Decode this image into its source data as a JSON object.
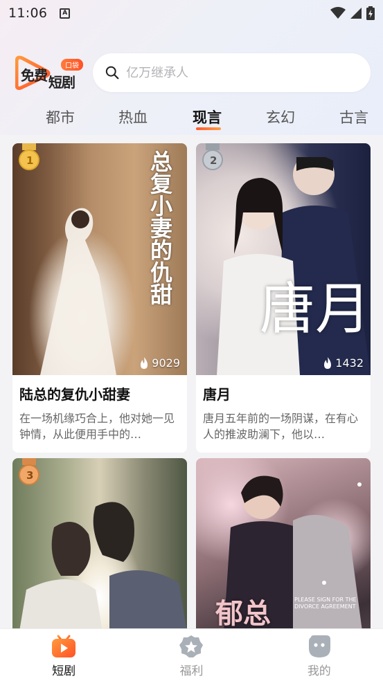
{
  "status": {
    "time": "11:06",
    "app_icon": "A"
  },
  "brand": {
    "text1": "免费",
    "text2": "短剧",
    "badge": "口袋"
  },
  "search": {
    "placeholder": "亿万继承人"
  },
  "tabs": [
    {
      "label": "都市"
    },
    {
      "label": "热血"
    },
    {
      "label": "现言"
    },
    {
      "label": "玄幻"
    },
    {
      "label": "古言"
    }
  ],
  "active_tab": "现言",
  "cards": [
    {
      "rank": "1",
      "views": "9029",
      "title": "陆总的复仇小甜妻",
      "desc": "在一场机缘巧合上，他对她一见钟情，从此便用手中的…",
      "poster_text": "总复小妻的仇甜"
    },
    {
      "rank": "2",
      "views": "1432",
      "title": "唐月",
      "desc": "唐月五年前的一场阴谋，在有心人的推波助澜下，他以…",
      "poster_text": "唐月"
    },
    {
      "rank": "3",
      "views": "",
      "title": "",
      "desc": "",
      "poster_text": ""
    },
    {
      "rank": "",
      "views": "",
      "title": "",
      "desc": "",
      "poster_text": "郁总",
      "poster_sub": "PLEASE SIGN FOR THE DIVORCE AGREEMENT"
    }
  ],
  "bottom_nav": [
    {
      "label": "短剧",
      "icon": "tv-play-icon",
      "active": true
    },
    {
      "label": "福利",
      "icon": "star-badge-icon",
      "active": false
    },
    {
      "label": "我的",
      "icon": "ghost-face-icon",
      "active": false
    }
  ],
  "colors": {
    "accent": "#ff5a2b",
    "accent2": "#ff9d46",
    "background": "#f3f3f5"
  }
}
